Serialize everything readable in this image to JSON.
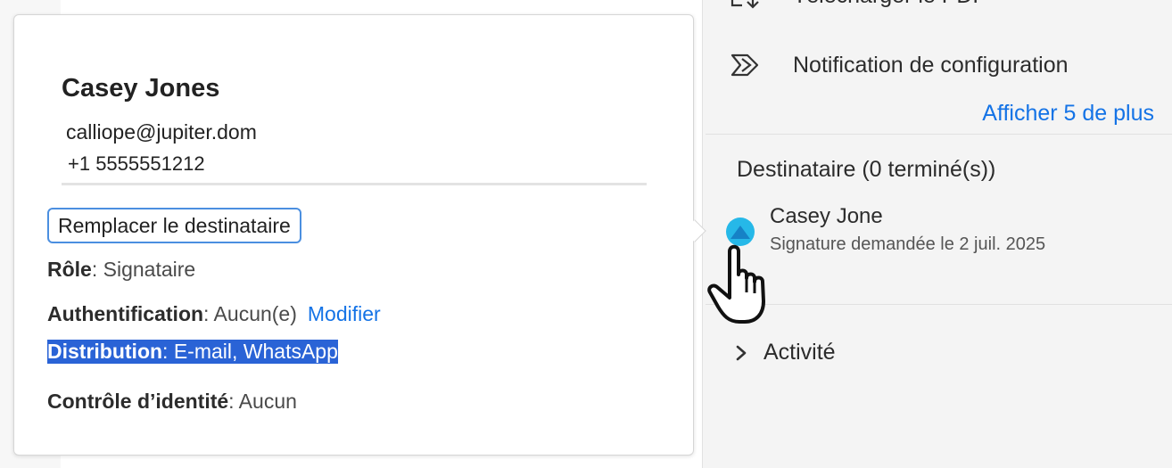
{
  "right_panel": {
    "actions": [
      {
        "label": "Télécharger le PDF",
        "icon": "download-pdf-icon"
      },
      {
        "label": "Notification de configuration",
        "icon": "notification-config-icon"
      }
    ],
    "show_more": "Afficher 5 de plus",
    "recipients_heading": "Destinataire (0 terminé(s))",
    "recipient": {
      "name": "Casey Jone",
      "status": "Signature demandée le 2 juil. 2025",
      "avatar_color": "#26b8e8"
    },
    "activity_label": "Activité"
  },
  "card": {
    "name": "Casey Jones",
    "email": "calliope@jupiter.dom",
    "phone": "+1 5555551212",
    "replace_button": "Remplacer le destinataire",
    "role_key": "Rôle",
    "role_value": ": Signataire",
    "auth_key": "Authentification",
    "auth_value": ": Aucun(e)",
    "auth_link": "Modifier",
    "distribution_key": "Distribution",
    "distribution_value": ": E-mail, WhatsApp",
    "identity_key": "Contrôle d’identité",
    "identity_value": ": Aucun"
  },
  "colors": {
    "accent": "#1473e6",
    "selection": "#2a63d6",
    "button_border": "#4b8fe0"
  }
}
